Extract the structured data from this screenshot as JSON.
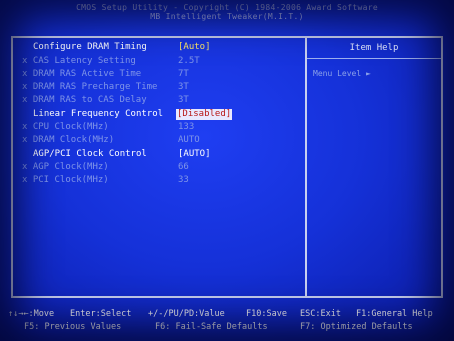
{
  "header": {
    "line1": "CMOS Setup Utility - Copyright (C) 1984-2006 Award Software",
    "line2": "MB Intelligent Tweaker(M.I.T.)"
  },
  "help": {
    "title": "Item Help",
    "menu_level": "Menu Level  ►"
  },
  "settings": [
    {
      "prefix": "",
      "label": "Configure DRAM Timing",
      "value": "[Auto]",
      "state": "header"
    },
    {
      "prefix": "x",
      "label": "CAS Latency Setting",
      "value": "2.5T",
      "state": "disabled"
    },
    {
      "prefix": "x",
      "label": "DRAM RAS Active Time",
      "value": "7T",
      "state": "disabled"
    },
    {
      "prefix": "x",
      "label": "DRAM RAS Precharge Time",
      "value": "3T",
      "state": "disabled"
    },
    {
      "prefix": "x",
      "label": "DRAM RAS to CAS Delay",
      "value": "3T",
      "state": "disabled"
    },
    {
      "prefix": "",
      "label": "Linear Frequency Control",
      "value": "[Disabled]",
      "state": "selected"
    },
    {
      "prefix": "x",
      "label": "CPU Clock(MHz)",
      "value": "133",
      "state": "disabled"
    },
    {
      "prefix": "x",
      "label": "DRAM Clock(MHz)",
      "value": "AUTO",
      "state": "disabled"
    },
    {
      "prefix": "",
      "label": "AGP/PCI Clock Control",
      "value": "[AUTO]",
      "state": "active"
    },
    {
      "prefix": "x",
      "label": "AGP Clock(MHz)",
      "value": "66",
      "state": "disabled"
    },
    {
      "prefix": "x",
      "label": "PCI Clock(MHz)",
      "value": "33",
      "state": "disabled"
    }
  ],
  "footer": {
    "move": "↑↓→←:Move",
    "select": "Enter:Select",
    "value": "+/-/PU/PD:Value",
    "save": "F10:Save",
    "exit": "ESC:Exit",
    "help": "F1:General Help",
    "prev": "F5: Previous Values",
    "failsafe": "F6: Fail-Safe Defaults",
    "optimized": "F7: Optimized Defaults"
  }
}
